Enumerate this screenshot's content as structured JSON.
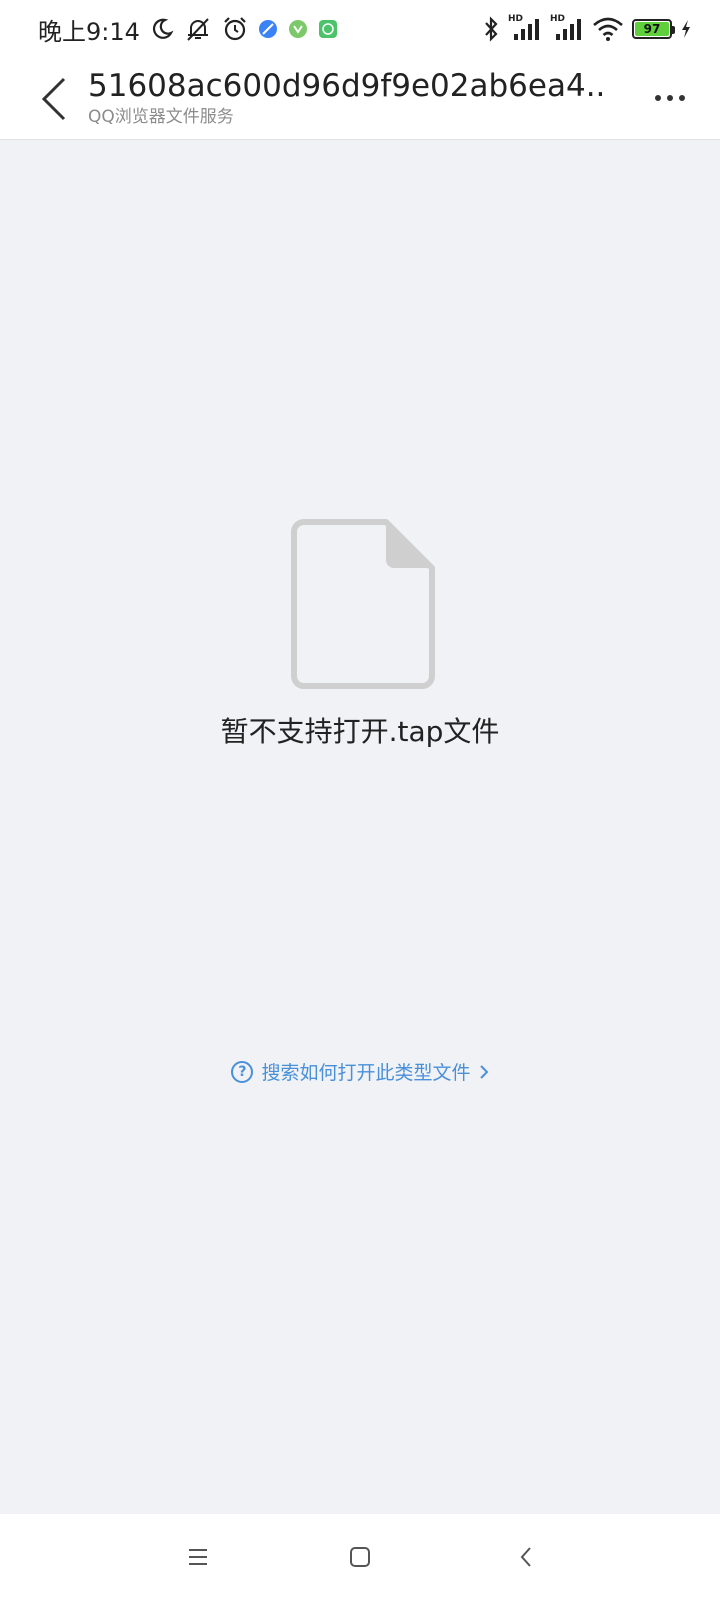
{
  "status_bar": {
    "time": "晚上9:14",
    "battery_level": "97",
    "hd_label_1": "HD",
    "hd_label_2": "HD",
    "icons": [
      "moon-icon",
      "mute-icon",
      "alarm-icon",
      "browser-app-icon",
      "security-app-icon",
      "android-app-icon",
      "bluetooth-icon",
      "signal-icon",
      "signal-icon",
      "wifi-icon",
      "battery-icon",
      "charging-icon"
    ]
  },
  "header": {
    "title": "51608ac600d96d9f9e02ab6ea4...",
    "subtitle": "QQ浏览器文件服务"
  },
  "content": {
    "message": "暂不支持打开.tap文件",
    "help_link": "搜索如何打开此类型文件",
    "help_icon_glyph": "?"
  },
  "colors": {
    "background": "#f0f2f6",
    "link": "#4a90d9",
    "file_icon": "#cfcfcf"
  }
}
